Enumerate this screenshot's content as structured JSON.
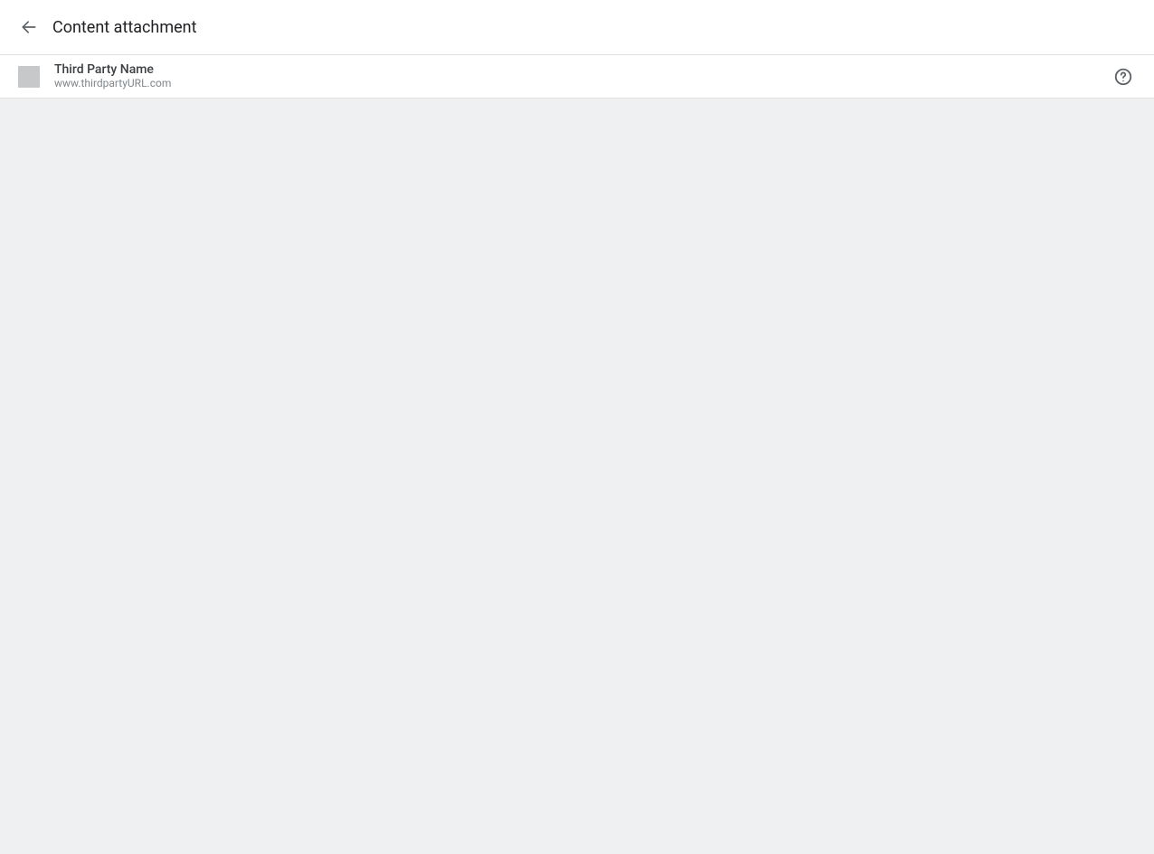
{
  "header": {
    "title": "Content attachment"
  },
  "context": {
    "name": "Third Party Name",
    "url": "www.thirdpartyURL.com"
  }
}
